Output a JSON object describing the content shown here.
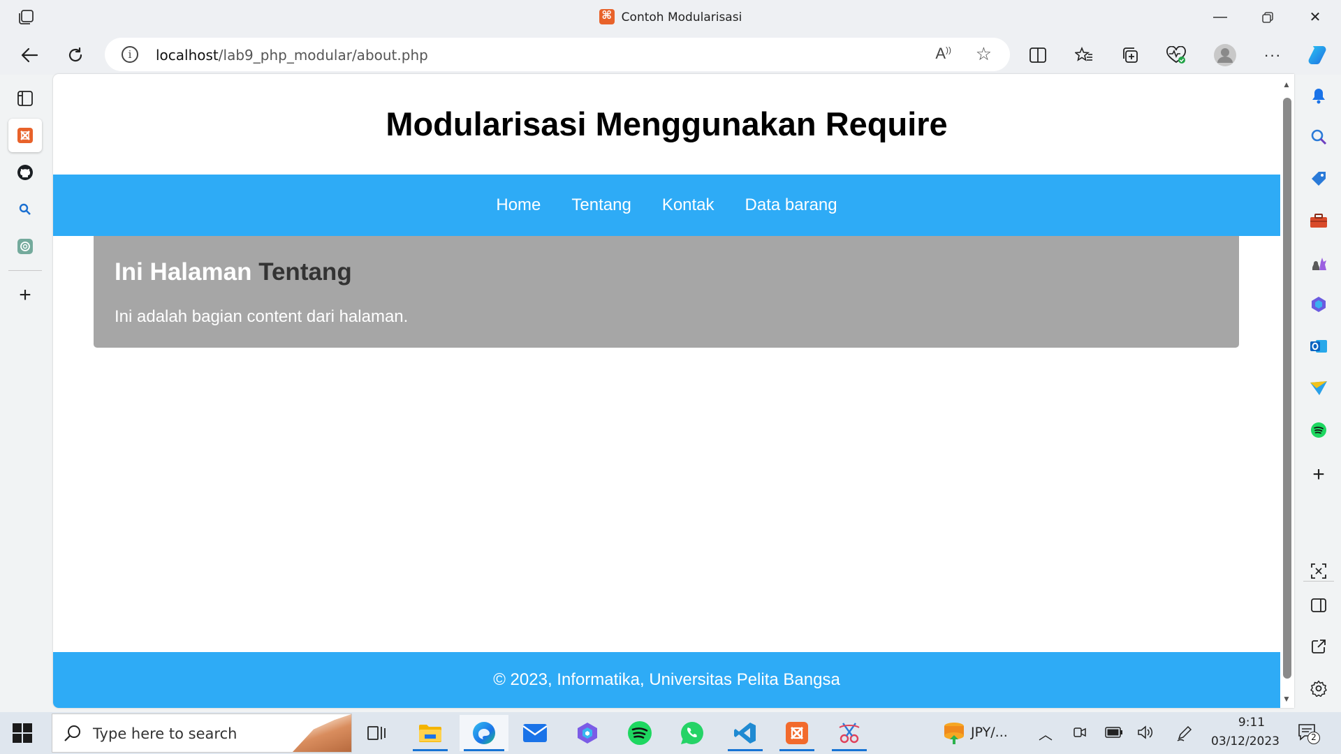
{
  "window": {
    "title": "Contoh Modularisasi"
  },
  "address_bar": {
    "host": "localhost",
    "path": "/lab9_php_modular/about.php",
    "read_aloud_label": "Aʹʹ"
  },
  "page": {
    "header_title": "Modularisasi Menggunakan Require",
    "nav": [
      "Home",
      "Tentang",
      "Kontak",
      "Data barang"
    ],
    "content_heading_light": "Ini Halaman",
    "content_heading_dark": "Tentang",
    "content_text": "Ini adalah bagian content dari halaman.",
    "footer_text": "© 2023, Informatika, Universitas Pelita Bangsa"
  },
  "left_sidebar": [
    "tabs-icon",
    "xampp-icon",
    "github-icon",
    "search-icon",
    "chatgpt-icon",
    "add-icon"
  ],
  "right_sidebar": [
    "bell-icon",
    "search-icon",
    "tag-icon",
    "toolbox-icon",
    "games-icon",
    "copilot-icon",
    "outlook-icon",
    "send-icon",
    "spotify-icon",
    "add-icon",
    "screenshot-icon",
    "sidebar-icon",
    "external-link-icon",
    "settings-icon"
  ],
  "taskbar": {
    "search_placeholder": "Type here to search",
    "apps": [
      "task-view-icon",
      "file-explorer-icon",
      "edge-icon",
      "mail-icon",
      "copilot-icon",
      "spotify-icon",
      "whatsapp-icon",
      "vscode-icon",
      "xampp-icon",
      "snipping-tool-icon"
    ],
    "widget_text": "JPY/...",
    "time": "9:11",
    "date": "03/12/2023",
    "notification_count": "2"
  },
  "colors": {
    "nav_blue": "#2eabf6",
    "content_gray": "#a6a6a6"
  }
}
